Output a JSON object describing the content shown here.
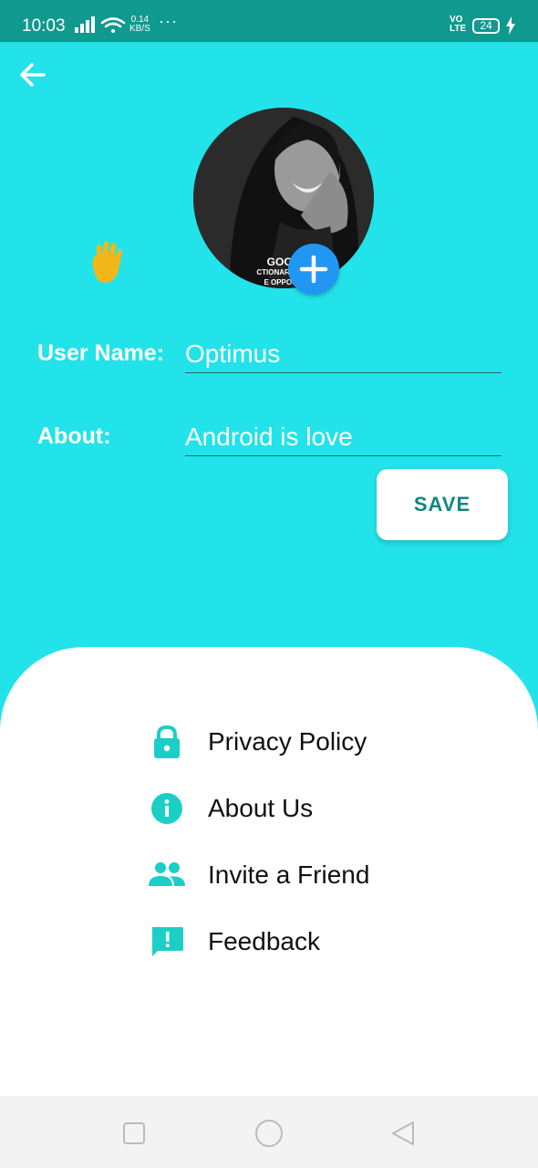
{
  "status_bar": {
    "time": "10:03",
    "speed_value": "0.14",
    "speed_unit": "KB/S",
    "more": "···",
    "network_top": "VO",
    "network_bottom": "LTE",
    "battery": "24"
  },
  "profile": {
    "photo_caption_line1": "GOOD",
    "photo_caption_line2": "CTIONARY SAY",
    "photo_caption_line3": "E OPPOSIT"
  },
  "form": {
    "username_label": "User Name:",
    "username_value": "Optimus",
    "about_label": "About:",
    "about_value": "Android is love",
    "save_label": "SAVE"
  },
  "menu": {
    "items": [
      {
        "label": "Privacy Policy",
        "icon": "lock-icon"
      },
      {
        "label": "About Us",
        "icon": "info-icon"
      },
      {
        "label": "Invite a Friend",
        "icon": "people-icon"
      },
      {
        "label": "Feedback",
        "icon": "feedback-icon"
      }
    ]
  },
  "colors": {
    "background": "#22e3e9",
    "status_bar": "#10998f",
    "accent": "#1ccfc6",
    "add_button": "#2196f3",
    "save_text": "#10877f"
  }
}
